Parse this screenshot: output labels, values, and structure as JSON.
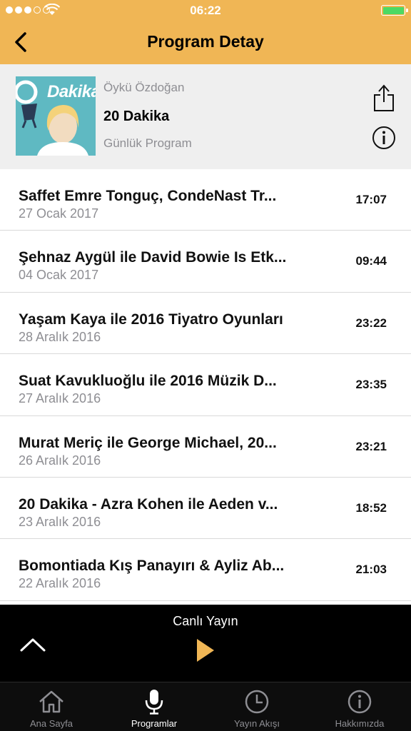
{
  "status_bar": {
    "time": "06:22"
  },
  "nav": {
    "title": "Program Detay",
    "back_icon": "chevron-left-icon"
  },
  "program": {
    "host": "Öykü Özdoğan",
    "title": "20 Dakika",
    "type": "Günlük Program",
    "cover_text": "Dakika",
    "share_icon": "share-icon",
    "info_icon": "info-icon"
  },
  "episodes": [
    {
      "title": "Saffet Emre Tonguç, CondeNast Tr...",
      "date": "27 Ocak 2017",
      "duration": "17:07"
    },
    {
      "title": "Şehnaz Aygül ile David Bowie Is Etk...",
      "date": "04 Ocak 2017",
      "duration": "09:44"
    },
    {
      "title": "Yaşam Kaya ile 2016 Tiyatro Oyunları",
      "date": "28 Aralık 2016",
      "duration": "23:22"
    },
    {
      "title": "Suat Kavukluoğlu ile 2016 Müzik D...",
      "date": "27 Aralık 2016",
      "duration": "23:35"
    },
    {
      "title": "Murat Meriç ile George Michael, 20...",
      "date": "26 Aralık 2016",
      "duration": "23:21"
    },
    {
      "title": "20 Dakika - Azra Kohen ile Aeden v...",
      "date": "23 Aralık 2016",
      "duration": "18:52"
    },
    {
      "title": "Bomontiada Kış Panayırı & Ayliz Ab...",
      "date": "22 Aralık 2016",
      "duration": "21:03"
    }
  ],
  "player": {
    "label": "Canlı Yayın",
    "expand_icon": "chevron-up-icon",
    "play_icon": "play-icon"
  },
  "tabs": [
    {
      "label": "Ana Sayfa",
      "icon": "home-icon",
      "active": false
    },
    {
      "label": "Programlar",
      "icon": "microphone-icon",
      "active": true
    },
    {
      "label": "Yayın Akışı",
      "icon": "clock-icon",
      "active": false
    },
    {
      "label": "Hakkımızda",
      "icon": "info-icon",
      "active": false
    }
  ],
  "colors": {
    "accent": "#f0b655",
    "play": "#f0b655",
    "battery": "#4cd964"
  }
}
